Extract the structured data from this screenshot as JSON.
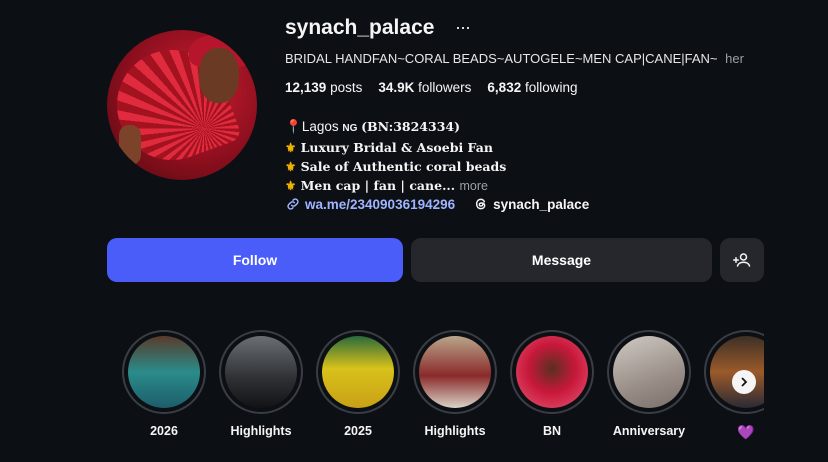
{
  "profile": {
    "username": "synach_palace",
    "more_icon": "more-icon",
    "category": "BRIDAL HANDFAN~CORAL BEADS~AUTOGELE~MEN CAP|CANE|FAN~",
    "category_suffix": "her"
  },
  "stats": {
    "posts_count": "12,139",
    "posts_label": "posts",
    "followers_count": "34.9K",
    "followers_label": "followers",
    "following_count": "6,832",
    "following_label": "following"
  },
  "bio": {
    "line1_location": "Lagos",
    "line1_flag": "NG",
    "line1_bn": "(BN:3824334)",
    "line2": "Luxury Bridal & Asoebi Fan",
    "line3": "Sale of Authentic coral beads",
    "line4": "Men cap | fan | cane...",
    "more": "more",
    "pin_glyph": "📍",
    "fleur_glyph": "⚜"
  },
  "links": {
    "website": "wa.me/23409036194296",
    "threads": "synach_palace"
  },
  "buttons": {
    "follow": "Follow",
    "message": "Message"
  },
  "highlights": [
    {
      "label": "2026"
    },
    {
      "label": "Highlights"
    },
    {
      "label": "2025"
    },
    {
      "label": "Highlights"
    },
    {
      "label": "BN"
    },
    {
      "label": "Anniversary"
    },
    {
      "label": "💜"
    }
  ],
  "colors": {
    "background": "#0c0f14",
    "follow_button": "#4a5df9",
    "secondary_button": "#25272c",
    "link": "#9fb4ff"
  }
}
